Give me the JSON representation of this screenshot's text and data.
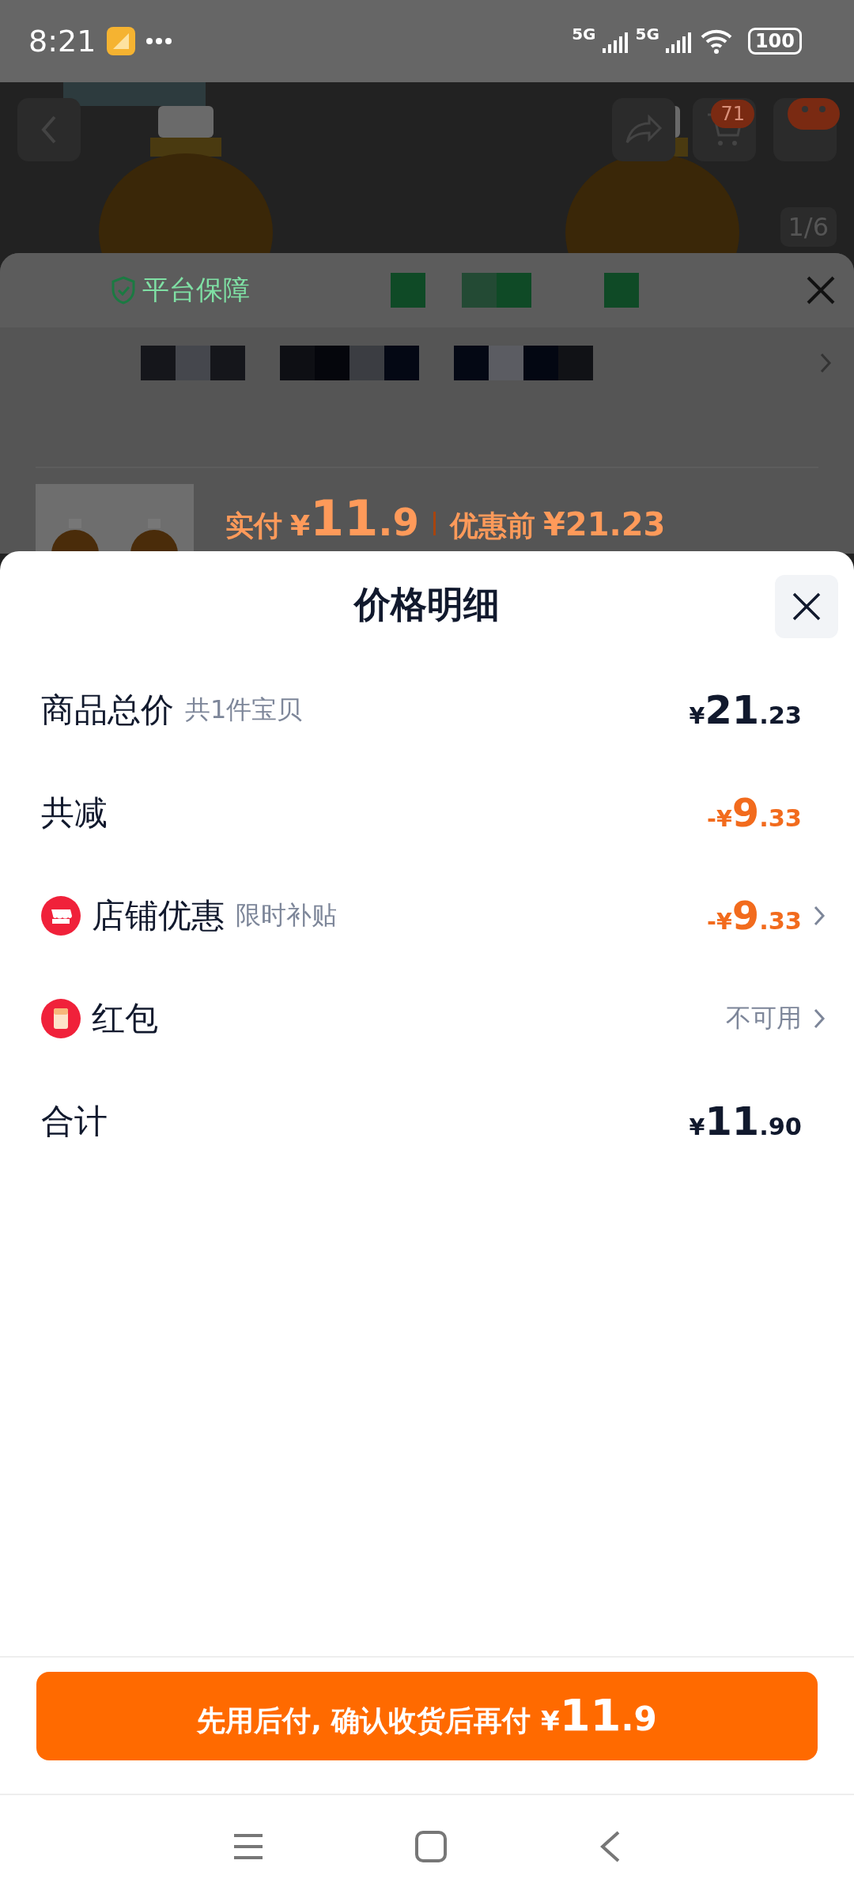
{
  "status_bar": {
    "time": "8:21",
    "network_1": "5G",
    "network_2": "5G",
    "battery": "100"
  },
  "product_header": {
    "cart_badge": "71",
    "image_counter": "1/6"
  },
  "back_sheet": {
    "guarantee": "平台保障",
    "pay_label": "实付",
    "pay_prefix": "¥",
    "pay_integer": "11",
    "pay_decimal": ".9",
    "before_label": "优惠前",
    "before_price": "¥21.23"
  },
  "price_sheet": {
    "title": "价格明细",
    "rows": [
      {
        "kind": "plain",
        "label": "商品总价",
        "note": "共1件宝贝",
        "color": "#11192d",
        "chevron": false,
        "value": {
          "prefix": "¥",
          "integer": "21",
          "decimal": ".23"
        }
      },
      {
        "kind": "plain",
        "label": "共减",
        "color": "#f26b1d",
        "chevron": false,
        "value": {
          "prefix": "-¥",
          "integer": "9",
          "decimal": ".33"
        }
      },
      {
        "kind": "store",
        "label": "店铺优惠",
        "note": "限时补贴",
        "color": "#f26b1d",
        "chevron": true,
        "value": {
          "prefix": "-¥",
          "integer": "9",
          "decimal": ".33"
        }
      },
      {
        "kind": "red_packet",
        "label": "红包",
        "color": "#7d8699",
        "chevron": true,
        "text_value": "不可用"
      },
      {
        "kind": "plain",
        "label": "合计",
        "color": "#11192d",
        "chevron": false,
        "value": {
          "prefix": "¥",
          "integer": "11",
          "decimal": ".90"
        }
      }
    ],
    "pay_button": {
      "label": "先用后付, 确认收货后再付",
      "prefix": "¥",
      "integer": "11",
      "decimal": ".9"
    }
  }
}
